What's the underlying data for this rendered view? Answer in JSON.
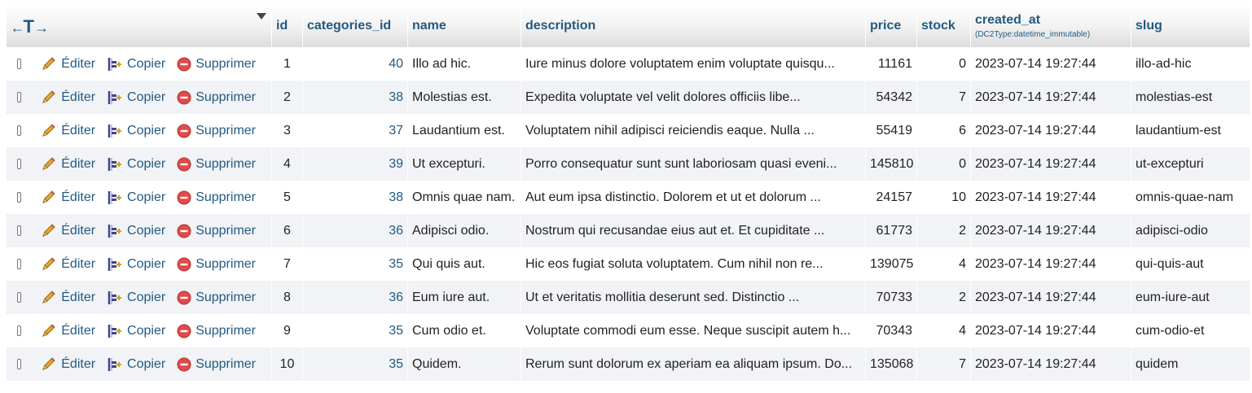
{
  "header": {
    "columns": [
      {
        "key": "id",
        "label": "id"
      },
      {
        "key": "categories_id",
        "label": "categories_id"
      },
      {
        "key": "name",
        "label": "name"
      },
      {
        "key": "description",
        "label": "description"
      },
      {
        "key": "price",
        "label": "price"
      },
      {
        "key": "stock",
        "label": "stock"
      },
      {
        "key": "created_at",
        "label": "created_at",
        "sub": "(DC2Type:datetime_immutable)"
      },
      {
        "key": "slug",
        "label": "slug"
      }
    ]
  },
  "actions": {
    "edit_label": "Éditer",
    "copy_label": "Copier",
    "delete_label": "Supprimer"
  },
  "rows": [
    {
      "id": "1",
      "categories_id": "40",
      "name": "Illo ad hic.",
      "description": "Iure minus dolore voluptatem enim voluptate quisqu...",
      "price": "11161",
      "stock": "0",
      "created_at": "2023-07-14 19:27:44",
      "slug": "illo-ad-hic"
    },
    {
      "id": "2",
      "categories_id": "38",
      "name": "Molestias est.",
      "description": "Expedita voluptate vel velit dolores officiis libe...",
      "price": "54342",
      "stock": "7",
      "created_at": "2023-07-14 19:27:44",
      "slug": "molestias-est"
    },
    {
      "id": "3",
      "categories_id": "37",
      "name": "Laudantium est.",
      "description": "Voluptatem nihil adipisci reiciendis eaque. Nulla ...",
      "price": "55419",
      "stock": "6",
      "created_at": "2023-07-14 19:27:44",
      "slug": "laudantium-est"
    },
    {
      "id": "4",
      "categories_id": "39",
      "name": "Ut excepturi.",
      "description": "Porro consequatur sunt sunt laboriosam quasi eveni...",
      "price": "145810",
      "stock": "0",
      "created_at": "2023-07-14 19:27:44",
      "slug": "ut-excepturi"
    },
    {
      "id": "5",
      "categories_id": "38",
      "name": "Omnis quae nam.",
      "description": "Aut eum ipsa distinctio. Dolorem et ut et dolorum ...",
      "price": "24157",
      "stock": "10",
      "created_at": "2023-07-14 19:27:44",
      "slug": "omnis-quae-nam"
    },
    {
      "id": "6",
      "categories_id": "36",
      "name": "Adipisci odio.",
      "description": "Nostrum qui recusandae eius aut et. Et cupiditate ...",
      "price": "61773",
      "stock": "2",
      "created_at": "2023-07-14 19:27:44",
      "slug": "adipisci-odio"
    },
    {
      "id": "7",
      "categories_id": "35",
      "name": "Qui quis aut.",
      "description": "Hic eos fugiat soluta voluptatem. Cum nihil non re...",
      "price": "139075",
      "stock": "4",
      "created_at": "2023-07-14 19:27:44",
      "slug": "qui-quis-aut"
    },
    {
      "id": "8",
      "categories_id": "36",
      "name": "Eum iure aut.",
      "description": "Ut et veritatis mollitia deserunt sed. Distinctio ...",
      "price": "70733",
      "stock": "2",
      "created_at": "2023-07-14 19:27:44",
      "slug": "eum-iure-aut"
    },
    {
      "id": "9",
      "categories_id": "35",
      "name": "Cum odio et.",
      "description": "Voluptate commodi eum esse. Neque suscipit autem h...",
      "price": "70343",
      "stock": "4",
      "created_at": "2023-07-14 19:27:44",
      "slug": "cum-odio-et"
    },
    {
      "id": "10",
      "categories_id": "35",
      "name": "Quidem.",
      "description": "Rerum sunt dolorum ex aperiam ea aliquam ipsum. Do...",
      "price": "135068",
      "stock": "7",
      "created_at": "2023-07-14 19:27:44",
      "slug": "quidem"
    }
  ],
  "colors": {
    "link": "#235a81",
    "row_alt": "#f1f3f6",
    "delete_icon": "#e04b4b",
    "pencil_icon": "#e8a631"
  }
}
